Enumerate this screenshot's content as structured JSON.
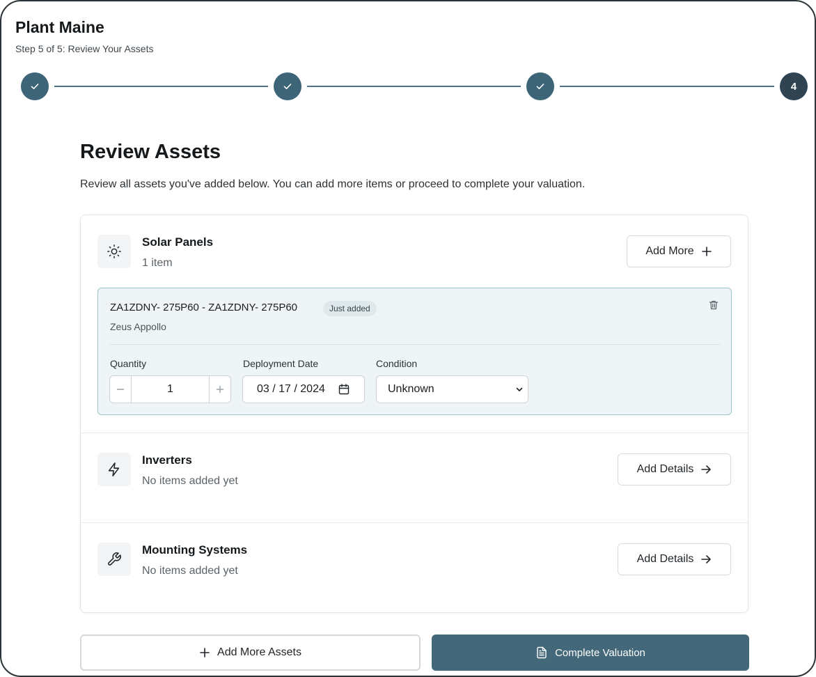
{
  "header": {
    "title": "Plant Maine",
    "step_text": "Step 5 of 5: Review Your Assets"
  },
  "stepper": {
    "steps": [
      {
        "state": "complete",
        "icon": "check-icon"
      },
      {
        "state": "complete",
        "icon": "check-icon"
      },
      {
        "state": "complete",
        "icon": "check-icon"
      },
      {
        "state": "current",
        "label": "4"
      }
    ],
    "accent": "#3d6577"
  },
  "main": {
    "heading": "Review Assets",
    "description": "Review all assets you've added below. You can add more items or proceed to complete your valuation.",
    "categories": [
      {
        "name": "Solar Panels",
        "subtitle": "1 item",
        "icon": "sun-icon",
        "action_label": "Add More",
        "action_icon": "plus-icon",
        "items": [
          {
            "title": "ZA1ZDNY- 275P60 - ZA1ZDNY- 275P60",
            "badge": "Just added",
            "brand": "Zeus Appollo",
            "quantity_label": "Quantity",
            "quantity": "1",
            "date_label": "Deployment Date",
            "date": "03 / 17 / 2024",
            "condition_label": "Condition",
            "condition": "Unknown"
          }
        ]
      },
      {
        "name": "Inverters",
        "subtitle": "No items added yet",
        "icon": "lightning-icon",
        "action_label": "Add Details",
        "action_icon": "arrow-right-icon"
      },
      {
        "name": "Mounting Systems",
        "subtitle": "No items added yet",
        "icon": "wrench-icon",
        "action_label": "Add Details",
        "action_icon": "arrow-right-icon"
      }
    ]
  },
  "footer": {
    "add_more_label": "Add More Assets",
    "complete_label": "Complete Valuation",
    "primary_color": "#42687a"
  }
}
